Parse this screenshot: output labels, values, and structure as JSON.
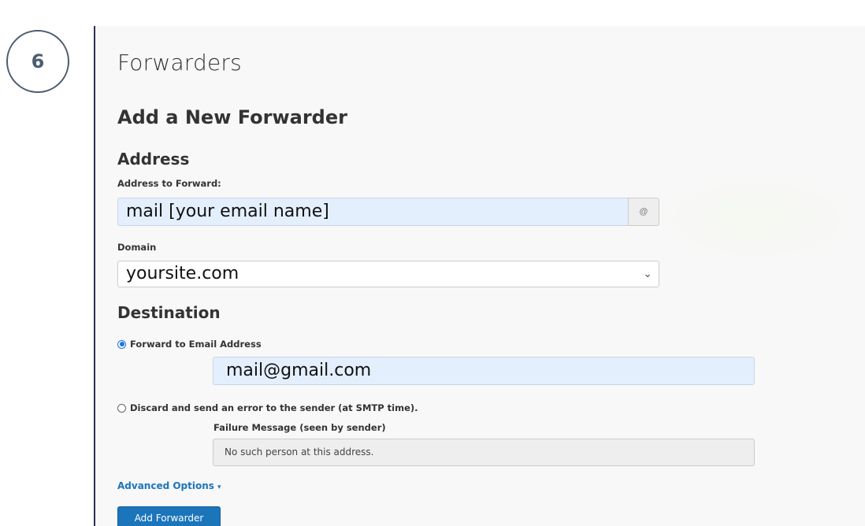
{
  "step": {
    "number": "6"
  },
  "page": {
    "title": "Forwarders",
    "section_title": "Add a New Forwarder"
  },
  "address": {
    "heading": "Address",
    "forward_label": "Address to Forward:",
    "forward_value": "mail [your email name]",
    "at_symbol": "@",
    "domain_label": "Domain",
    "domain_value": "yoursite.com",
    "chevron_icon": "chevron-down-icon"
  },
  "destination": {
    "heading": "Destination",
    "forward_option_label": "Forward to Email Address",
    "forward_option_checked": true,
    "forward_email_value": "mail@gmail.com",
    "discard_option_label": "Discard and send an error to the sender (at SMTP time).",
    "discard_option_checked": false,
    "failure_label": "Failure Message (seen by sender)",
    "failure_value": "No such person at this address."
  },
  "advanced": {
    "label": "Advanced Options",
    "caret": "▾"
  },
  "submit": {
    "label": "Add Forwarder"
  },
  "colors": {
    "accent": "#1b75bb",
    "radio": "#1a73e8",
    "autofill_bg": "#e4effd",
    "badge_border": "#4c5d70",
    "panel_border": "#2b2f54"
  }
}
